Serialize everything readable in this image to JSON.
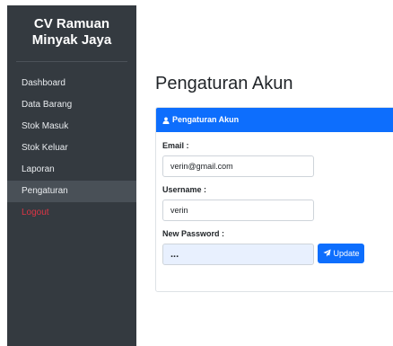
{
  "sidebar": {
    "brand": "CV Ramuan Minyak Jaya",
    "items": [
      {
        "label": "Dashboard"
      },
      {
        "label": "Data Barang"
      },
      {
        "label": "Stok Masuk"
      },
      {
        "label": "Stok Keluar"
      },
      {
        "label": "Laporan"
      },
      {
        "label": "Pengaturan"
      },
      {
        "label": "Logout"
      }
    ],
    "active_item": "Pengaturan"
  },
  "main": {
    "title": "Pengaturan Akun"
  },
  "card": {
    "header_icon": "user-icon",
    "header": "Pengaturan Akun",
    "email_label": "Email :",
    "email_value": "verin@gmail.com",
    "username_label": "Username :",
    "username_value": "verin",
    "password_label": "New Password :",
    "password_value": "...",
    "button_icon": "send-icon",
    "button_label": "Update"
  },
  "colors": {
    "sidebar_bg": "#343a40",
    "accent": "#0d6efd",
    "logout": "#dc3545"
  }
}
